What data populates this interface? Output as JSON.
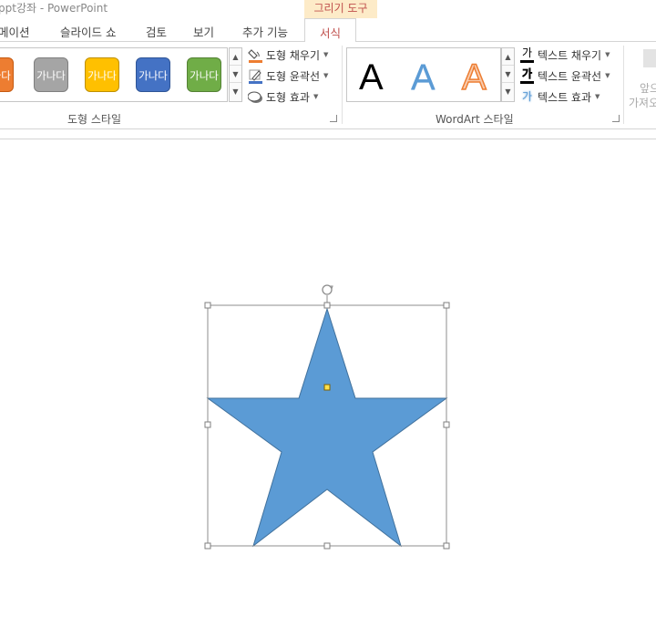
{
  "window": {
    "title": "ppt강좌 - PowerPoint",
    "context_tab_header": "그리기 도구"
  },
  "tabs": [
    {
      "label": "메이션",
      "active": false
    },
    {
      "label": "슬라이드 쇼",
      "active": false
    },
    {
      "label": "검토",
      "active": false
    },
    {
      "label": "보기",
      "active": false
    },
    {
      "label": "추가 기능",
      "active": false
    },
    {
      "label": "서식",
      "active": true
    }
  ],
  "shape_styles": {
    "group_label": "도형 스타일",
    "gallery": [
      {
        "label": "가나다",
        "color": "#ed7d31"
      },
      {
        "label": "가나다",
        "color": "#a5a5a5"
      },
      {
        "label": "가나다",
        "color": "#ffc000"
      },
      {
        "label": "가나다",
        "color": "#4472c4"
      },
      {
        "label": "가나다",
        "color": "#70ad47"
      }
    ],
    "fill_label": "도형 채우기",
    "outline_label": "도형 윤곽선",
    "effects_label": "도형 효과"
  },
  "wordart_styles": {
    "group_label": "WordArt 스타일",
    "letters": [
      {
        "label": "A",
        "style": "black"
      },
      {
        "label": "A",
        "style": "blue-gradient"
      },
      {
        "label": "A",
        "style": "orange-outline"
      }
    ],
    "text_fill_label": "텍스트 채우기",
    "text_outline_label": "텍스트 윤곽선",
    "text_effects_label": "텍스트 효과",
    "icon_glyph": "가"
  },
  "arrange": {
    "bring_forward_line1": "앞으",
    "bring_forward_line2": "가져오"
  },
  "colors": {
    "accent": "#c0504d",
    "star_fill": "#5b9bd5",
    "star_stroke": "#41719c",
    "handle_adjust": "#ffe14d"
  }
}
